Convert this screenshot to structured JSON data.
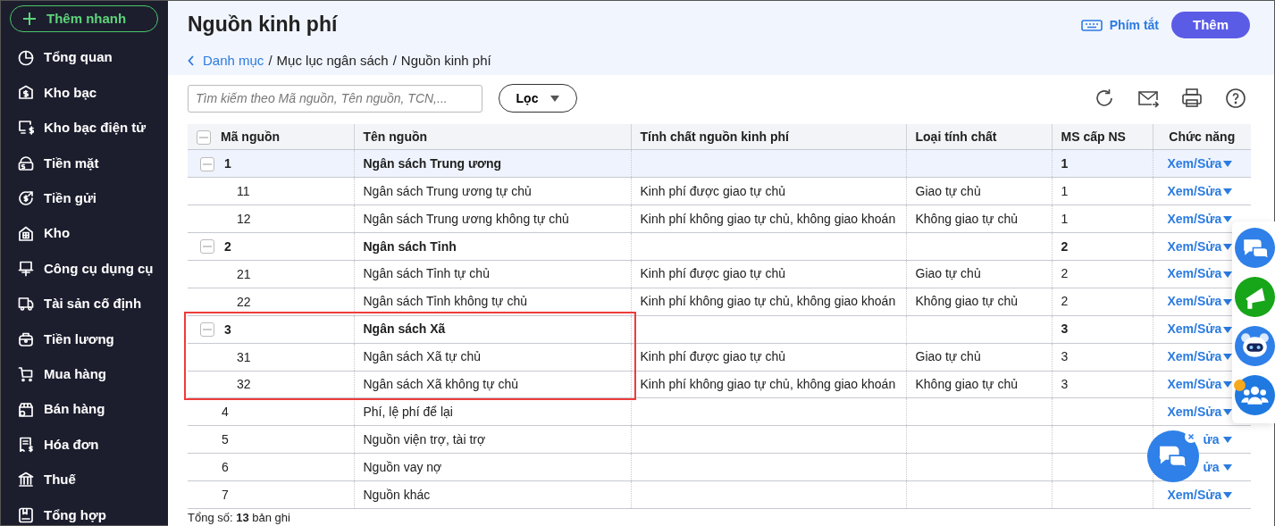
{
  "sidebar": {
    "quick_add": "Thêm nhanh",
    "items": [
      {
        "label": "Tổng quan"
      },
      {
        "label": "Kho bạc"
      },
      {
        "label": "Kho bạc điện tử"
      },
      {
        "label": "Tiền mặt"
      },
      {
        "label": "Tiền gửi"
      },
      {
        "label": "Kho"
      },
      {
        "label": "Công cụ dụng cụ"
      },
      {
        "label": "Tài sản cố định"
      },
      {
        "label": "Tiền lương"
      },
      {
        "label": "Mua hàng"
      },
      {
        "label": "Bán hàng"
      },
      {
        "label": "Hóa đơn"
      },
      {
        "label": "Thuế"
      },
      {
        "label": "Tổng hợp"
      }
    ]
  },
  "header": {
    "title": "Nguồn kinh phí",
    "shortcut": "Phím tắt",
    "add_button": "Thêm",
    "breadcrumb": {
      "separator": "/",
      "items": [
        {
          "label": "Danh mục",
          "kind": "link"
        },
        {
          "label": "Mục lục ngân sách",
          "kind": "text"
        },
        {
          "label": "Nguồn kinh phí",
          "kind": "text"
        }
      ]
    }
  },
  "toolbar": {
    "search": {
      "placeholder": "Tìm kiếm theo Mã nguồn, Tên nguồn, TCN,..."
    },
    "filter": "Lọc"
  },
  "table": {
    "expanded": true,
    "columns": [
      "Mã nguồn",
      "Tên nguồn",
      "Tính chất nguồn kinh phí",
      "Loại tính chất",
      "MS cấp NS",
      "Chức năng"
    ],
    "rows": [
      {
        "kind": "group",
        "code": "1",
        "name": "Ngân sách Trung ương",
        "ms": "1",
        "action": "Xem/Sửa",
        "selected": true,
        "expanded": true,
        "outlined": false,
        "children": [
          {
            "kind": "item",
            "code": "11",
            "name": "Ngân sách Trung ương tự chủ",
            "nature": "Kinh phí được giao tự chủ",
            "type": "Giao tự chủ",
            "ms": "1",
            "action": "Xem/Sửa",
            "selected": false
          },
          {
            "kind": "item",
            "code": "12",
            "name": "Ngân sách Trung ương không tự chủ",
            "nature": "Kinh phí không giao tự chủ, không giao khoán",
            "type": "Không giao tự chủ",
            "ms": "1",
            "action": "Xem/Sửa",
            "selected": false
          }
        ]
      },
      {
        "kind": "group",
        "code": "2",
        "name": "Ngân sách Tỉnh",
        "ms": "2",
        "action": "Xem/Sửa",
        "selected": false,
        "expanded": true,
        "outlined": false,
        "children": [
          {
            "kind": "item",
            "code": "21",
            "name": "Ngân sách Tỉnh tự chủ",
            "nature": "Kinh phí được giao tự chủ",
            "type": "Giao tự chủ",
            "ms": "2",
            "action": "Xem/Sửa",
            "selected": false
          },
          {
            "kind": "item",
            "code": "22",
            "name": "Ngân sách Tỉnh không tự chủ",
            "nature": "Kinh phí không giao tự chủ, không giao khoán",
            "type": "Không giao tự chủ",
            "ms": "2",
            "action": "Xem/Sửa",
            "selected": false
          }
        ]
      },
      {
        "kind": "group",
        "code": "3",
        "name": "Ngân sách Xã",
        "ms": "3",
        "action": "Xem/Sửa",
        "selected": false,
        "expanded": true,
        "outlined": true,
        "children": [
          {
            "kind": "item",
            "code": "31",
            "name": "Ngân sách Xã tự chủ",
            "nature": "Kinh phí được giao tự chủ",
            "type": "Giao tự chủ",
            "ms": "3",
            "action": "Xem/Sửa",
            "selected": false
          },
          {
            "kind": "item",
            "code": "32",
            "name": "Ngân sách Xã không tự chủ",
            "nature": "Kinh phí không giao tự chủ, không giao khoán",
            "type": "Không giao tự chủ",
            "ms": "3",
            "action": "Xem/Sửa",
            "selected": false
          }
        ]
      },
      {
        "kind": "item",
        "code": "4",
        "name": "Phí, lệ phí để lại",
        "action": "Xem/Sửa",
        "selected": false
      },
      {
        "kind": "item",
        "code": "5",
        "name": "Nguồn viện trợ, tài trợ",
        "action": "ửa",
        "selected": false
      },
      {
        "kind": "item",
        "code": "6",
        "name": "Nguồn vay nợ",
        "action": "ửa",
        "selected": false
      },
      {
        "kind": "item",
        "code": "7",
        "name": "Nguồn khác",
        "action": "Xem/Sửa",
        "selected": false
      }
    ]
  },
  "footer": "Tổng số:  **13** bản ghi"
}
